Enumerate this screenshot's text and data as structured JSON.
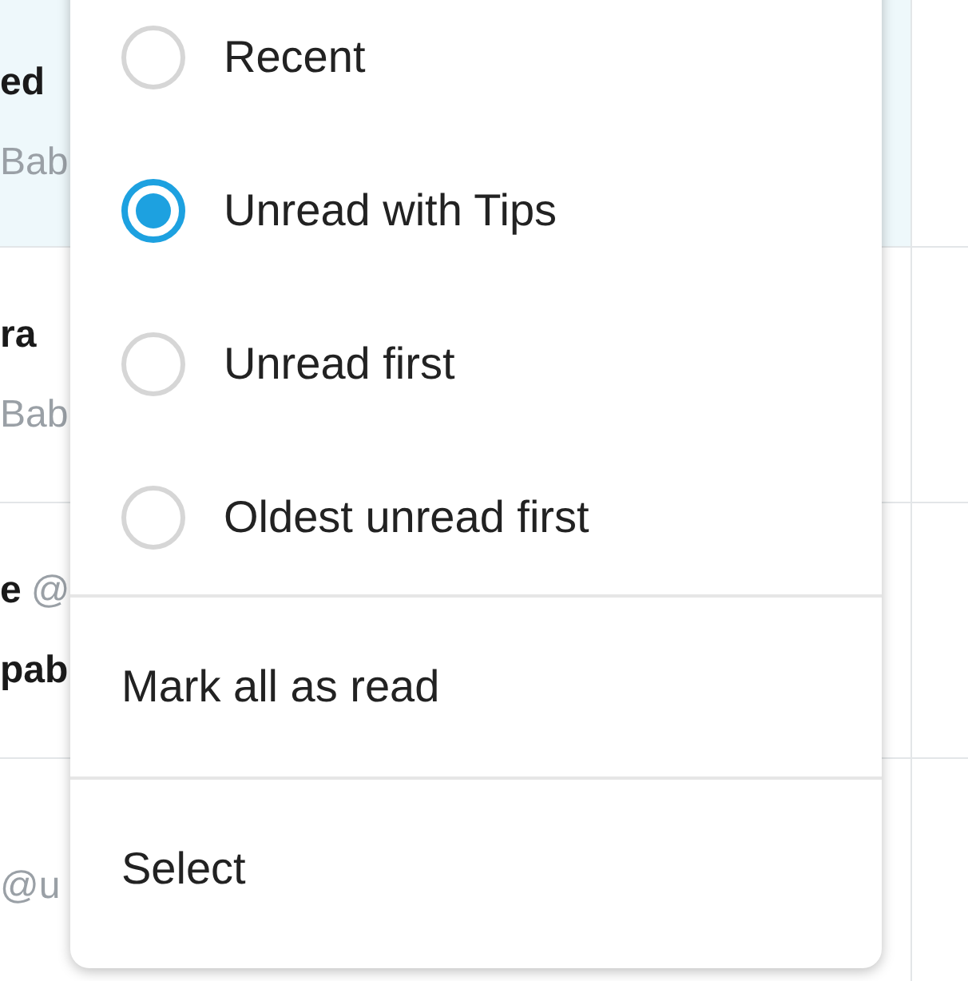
{
  "conversations": [
    {
      "highlighted": true,
      "lines": [
        [
          {
            "text": "ed",
            "kind": "name"
          }
        ],
        [
          {
            "text": "Bab",
            "kind": "muted"
          }
        ]
      ]
    },
    {
      "highlighted": false,
      "lines": [
        [
          {
            "text": "ra",
            "kind": "name"
          }
        ],
        [
          {
            "text": "Bab",
            "kind": "muted"
          }
        ]
      ]
    },
    {
      "highlighted": false,
      "lines": [
        [
          {
            "text": "e",
            "kind": "name"
          },
          {
            "text": "@",
            "kind": "muted"
          }
        ],
        [
          {
            "text": "pab",
            "kind": "preview"
          }
        ]
      ]
    },
    {
      "highlighted": false,
      "lines": [
        [
          {
            "text": "@u",
            "kind": "muted"
          }
        ]
      ]
    }
  ],
  "sort_menu": {
    "options": [
      {
        "label": "Recent",
        "selected": false
      },
      {
        "label": "Unread with Tips",
        "selected": true
      },
      {
        "label": "Unread first",
        "selected": false
      },
      {
        "label": "Oldest unread first",
        "selected": false
      }
    ],
    "actions": [
      {
        "label": "Mark all as read"
      },
      {
        "label": "Select"
      }
    ]
  }
}
